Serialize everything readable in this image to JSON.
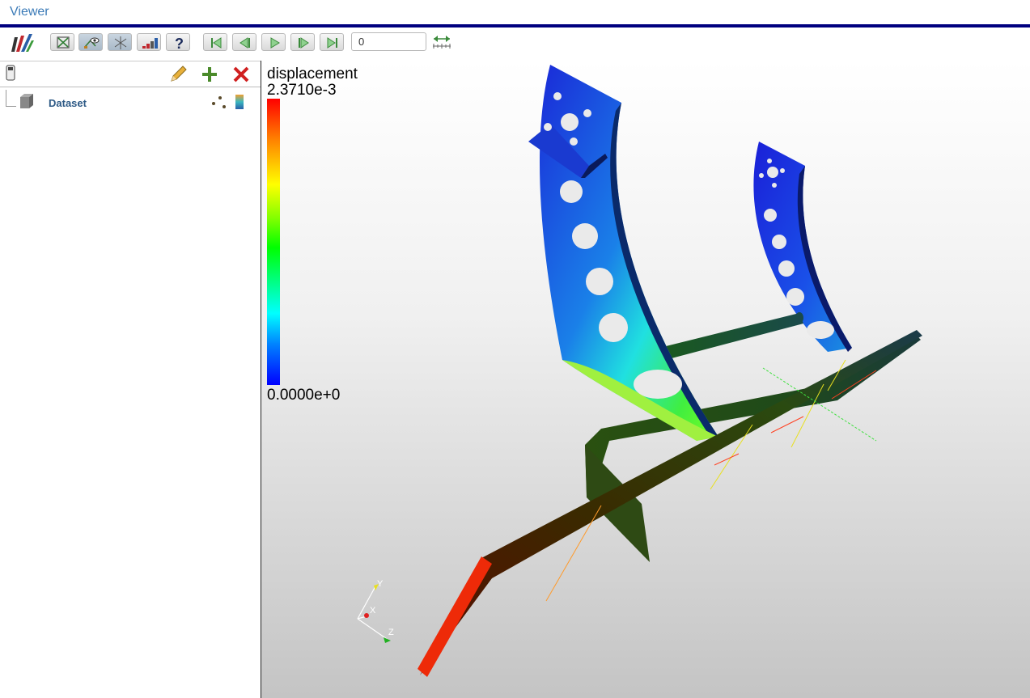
{
  "window": {
    "title": "Viewer"
  },
  "toolbar": {
    "buttons": [
      {
        "name": "reset-camera",
        "icon": "reset-camera-icon"
      },
      {
        "name": "toggle-visibility",
        "icon": "eye-icon"
      },
      {
        "name": "toggle-orientation-axes",
        "icon": "axes-icon"
      },
      {
        "name": "toggle-colorbar",
        "icon": "colorbar-icon"
      },
      {
        "name": "help",
        "icon": "question-icon"
      },
      {
        "name": "first-frame",
        "icon": "first-frame-icon"
      },
      {
        "name": "previous-frame",
        "icon": "previous-frame-icon"
      },
      {
        "name": "play",
        "icon": "play-icon"
      },
      {
        "name": "next-frame",
        "icon": "next-frame-icon"
      },
      {
        "name": "last-frame",
        "icon": "last-frame-icon"
      }
    ],
    "time_value": "0"
  },
  "pipeline": {
    "items": [
      {
        "label": "Dataset"
      }
    ]
  },
  "colorbar": {
    "title": "displacement",
    "max_label": "2.3710e-3",
    "min_label": "0.0000e+0"
  },
  "orientation_axes": {
    "x": "X",
    "y": "Y",
    "z": "Z"
  },
  "colors": {
    "title_rule": "#00007f",
    "title_text": "#3a7ab7",
    "dataset_label": "#2e5a86"
  }
}
